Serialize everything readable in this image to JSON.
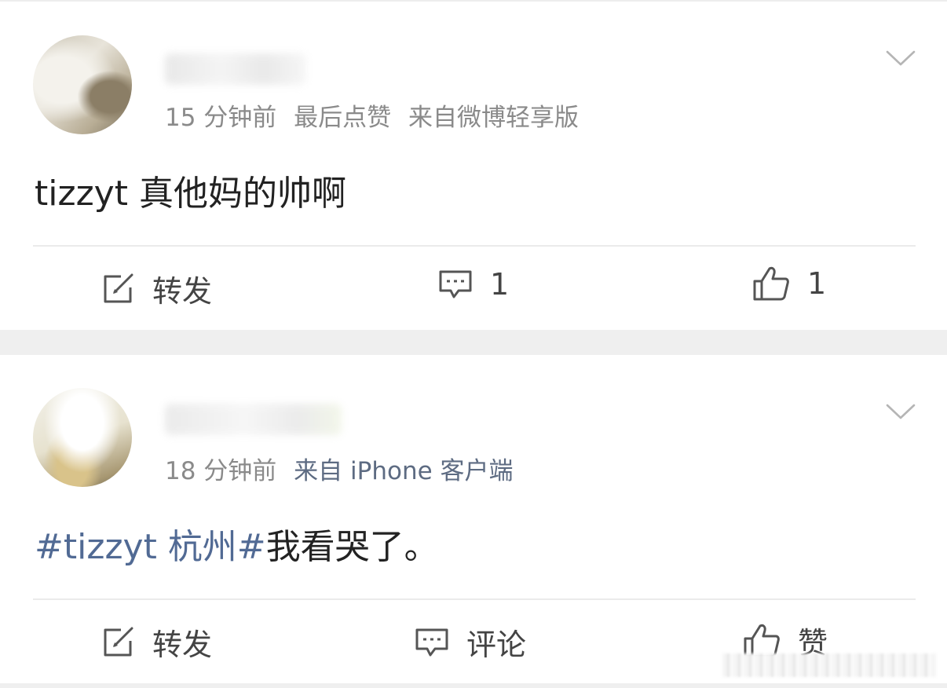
{
  "posts": [
    {
      "username": "",
      "time": "15 分钟前",
      "extra": "最后点赞",
      "source": "来自微博轻享版",
      "content": "tizzyt 真他妈的帅啊",
      "actions": {
        "repost_label": "转发",
        "comment_count": "1",
        "like_count": "1"
      }
    },
    {
      "username": "",
      "time": "18 分钟前",
      "source": "来自 iPhone 客户端",
      "content_tag": "#tizzyt 杭州#",
      "content_text": "我看哭了。",
      "actions": {
        "repost_label": "转发",
        "comment_label": "评论",
        "like_label": "赞"
      }
    }
  ],
  "icons": {
    "repost": "edit-icon",
    "comment": "comment-icon",
    "like": "thumbs-up-icon",
    "menu": "chevron-down-icon"
  },
  "colors": {
    "tag": "#516a94",
    "meta": "#8a8a8a",
    "background": "#efefef"
  }
}
